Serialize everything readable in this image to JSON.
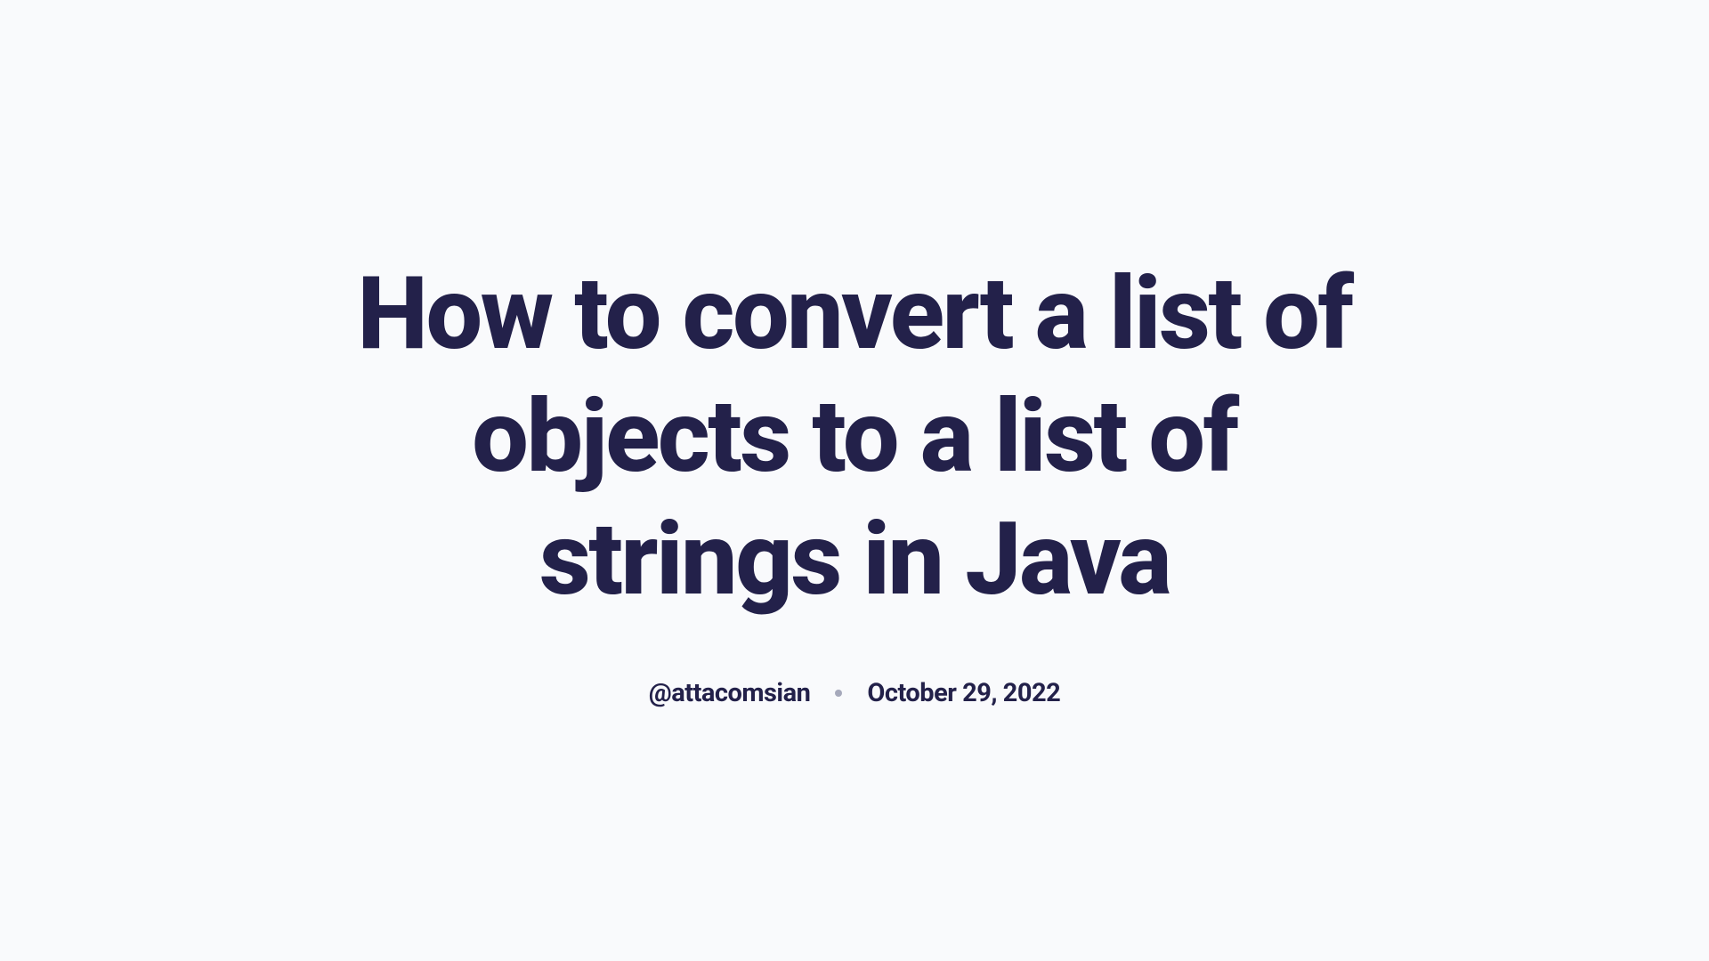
{
  "article": {
    "title": "How to convert a list of objects to a list of strings in Java",
    "author": "@attacomsian",
    "date": "October 29, 2022"
  }
}
